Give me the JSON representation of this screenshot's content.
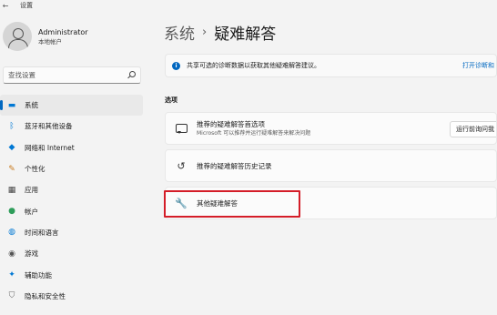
{
  "titlebar": {
    "back_glyph": "←",
    "title": "设置"
  },
  "profile": {
    "name": "Administrator",
    "account_type": "本地帐户"
  },
  "search": {
    "placeholder": "查找设置"
  },
  "nav": [
    {
      "label": "系统",
      "icon": "system-monitor-icon",
      "active": true
    },
    {
      "label": "蓝牙和其他设备",
      "icon": "bluetooth-icon"
    },
    {
      "label": "网络和 Internet",
      "icon": "wifi-icon"
    },
    {
      "label": "个性化",
      "icon": "brush-icon"
    },
    {
      "label": "应用",
      "icon": "apps-icon"
    },
    {
      "label": "帐户",
      "icon": "account-icon"
    },
    {
      "label": "时间和语言",
      "icon": "globe-clock-icon"
    },
    {
      "label": "游戏",
      "icon": "gamepad-icon"
    },
    {
      "label": "辅助功能",
      "icon": "accessibility-icon"
    },
    {
      "label": "隐私和安全性",
      "icon": "shield-icon"
    }
  ],
  "breadcrumb": {
    "parent": "系统",
    "separator": "›",
    "current": "疑难解答"
  },
  "banner": {
    "text": "共享可选的诊断数据以获取其他疑难解答建议。",
    "link": "打开诊断和"
  },
  "section": {
    "title": "选项"
  },
  "cards": {
    "recommended_prefs": {
      "title": "推荐的疑难解答首选项",
      "subtitle": "Microsoft 可以推荐并运行疑难解答来解决问题",
      "button": "运行前询问我"
    },
    "history": {
      "title": "推荐的疑难解答历史记录"
    },
    "other": {
      "title": "其他疑难解答"
    }
  },
  "colors": {
    "accent": "#0067c0",
    "highlight_box": "#d41d28",
    "window_bg": "#f3f3f3"
  }
}
